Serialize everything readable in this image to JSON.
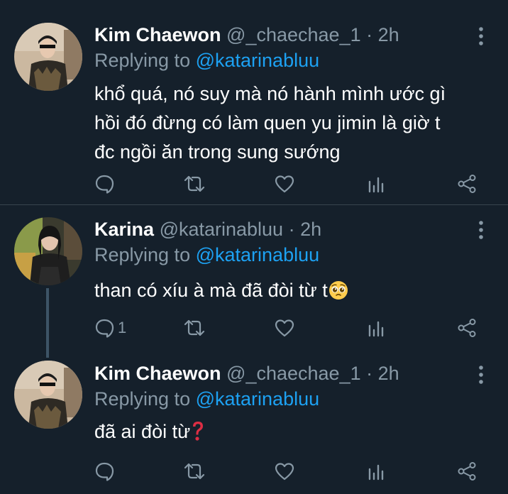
{
  "colors": {
    "background": "#15202b",
    "secondary_text": "#8899a6",
    "link": "#1da1f2",
    "divider": "#38444d",
    "thread_line": "#3d5466"
  },
  "tweets": [
    {
      "display_name": "Kim Chaewon",
      "handle": "@_chaechae_1",
      "separator": "·",
      "time": "2h",
      "replying_prefix": "Replying to",
      "replying_to": "@katarinabluu",
      "lines": [
        "khổ quá, nó suy mà nó hành mình ước gì",
        "hồi đó đừng có làm quen yu jimin là giờ t",
        "đc ngồi ăn trong sung sướng"
      ],
      "reply_count": "",
      "icons": [
        "comment-icon",
        "retweet-icon",
        "heart-icon",
        "stats-icon",
        "share-icon"
      ]
    },
    {
      "display_name": "Karina",
      "handle": "@katarinabluu",
      "separator": "·",
      "time": "2h",
      "replying_prefix": "Replying to",
      "replying_to": "@katarinabluu",
      "text": "than có xíu à mà đã đòi từ t",
      "emoji": "pleading-face-emoji",
      "reply_count": "1",
      "icons": [
        "comment-icon",
        "retweet-icon",
        "heart-icon",
        "stats-icon",
        "share-icon"
      ]
    },
    {
      "display_name": "Kim Chaewon",
      "handle": "@_chaechae_1",
      "separator": "·",
      "time": "2h",
      "replying_prefix": "Replying to",
      "replying_to": "@katarinabluu",
      "text": "đã ai đòi từ",
      "emoji": "red-question-mark-emoji",
      "reply_count": "",
      "icons": [
        "comment-icon",
        "retweet-icon",
        "heart-icon",
        "stats-icon",
        "share-icon"
      ]
    }
  ]
}
